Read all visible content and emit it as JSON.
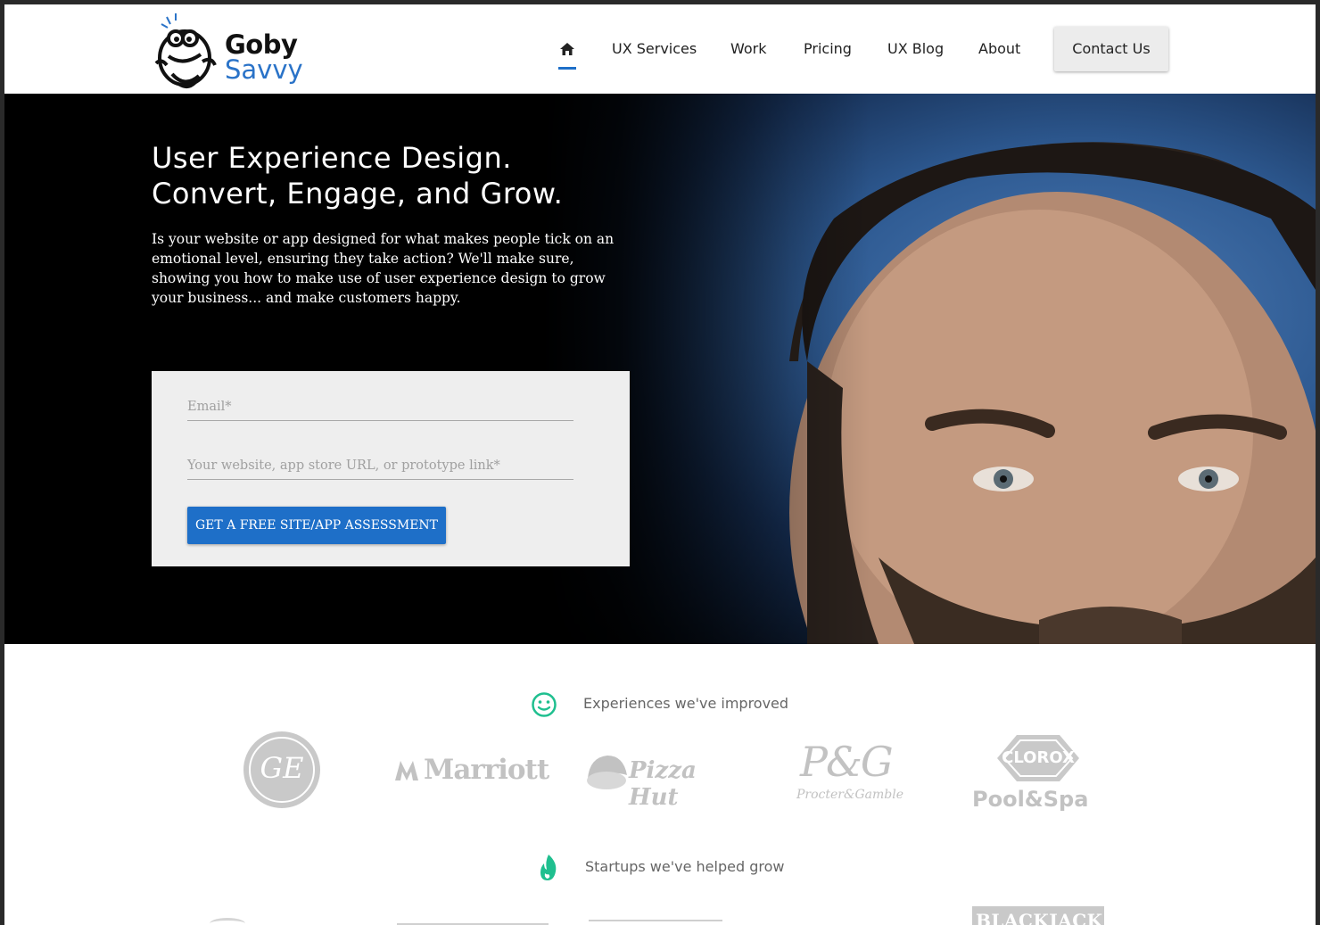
{
  "header": {
    "logo": {
      "line1": "Goby",
      "line2": "Savvy"
    },
    "nav": [
      {
        "label": "UX Services"
      },
      {
        "label": "Work"
      },
      {
        "label": "Pricing"
      },
      {
        "label": "UX Blog"
      },
      {
        "label": "About"
      }
    ],
    "contact_label": "Contact Us"
  },
  "hero": {
    "headline_line1": "User Experience Design.",
    "headline_line2": "Convert, Engage, and Grow.",
    "subtitle": "Is your website or app designed for what makes people tick on an emotional level, ensuring they take action? We'll make sure, showing you how to make use of user experience design to grow your business... and make customers happy.",
    "form": {
      "email_placeholder": "Email*",
      "url_placeholder": "Your website, app store URL, or prototype link*",
      "cta_label": "GET A FREE SITE/APP ASSESSMENT"
    }
  },
  "experiences": {
    "heading": "Experiences we've improved",
    "icon": "smiley-icon",
    "brands": [
      {
        "name": "GE"
      },
      {
        "name": "Marriott"
      },
      {
        "name": "Pizza Hut"
      },
      {
        "name": "P&G",
        "tagline": "Procter&Gamble"
      },
      {
        "name": "CLOROX",
        "tagline": "Pool&Spa"
      }
    ]
  },
  "startups": {
    "heading": "Startups we've helped grow",
    "icon": "flame-icon",
    "brands": [
      {
        "name": "BLACKJACK"
      }
    ]
  },
  "colors": {
    "accent": "#1e6fc8",
    "icon_green": "#1fbf8f",
    "logo_gray": "#c2c2c2"
  }
}
